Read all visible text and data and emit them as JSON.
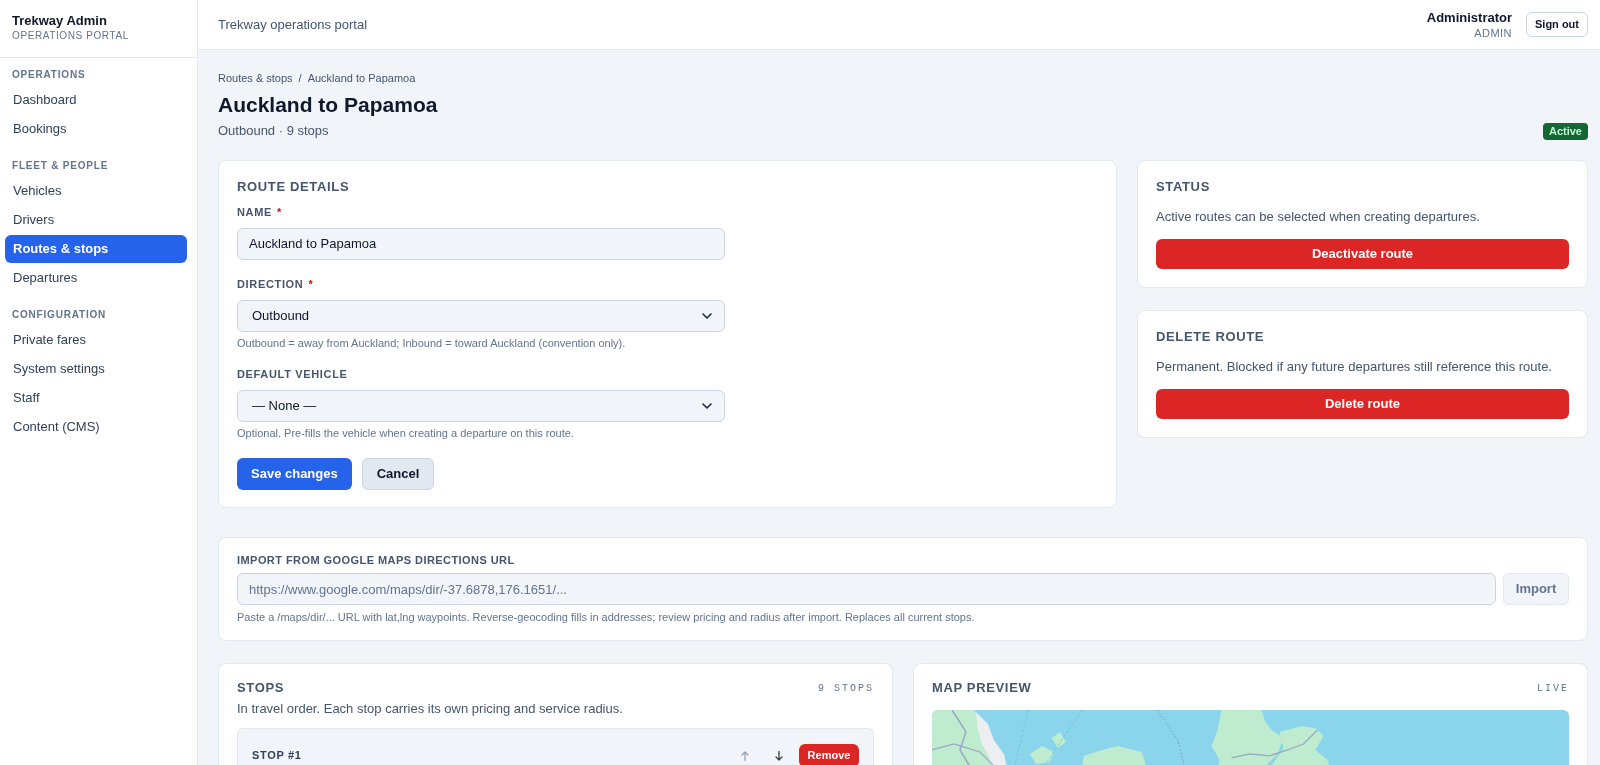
{
  "sidebar": {
    "brand": {
      "title": "Trekway Admin",
      "subtitle": "OPERATIONS PORTAL"
    },
    "sections": [
      {
        "label": "OPERATIONS",
        "items": [
          {
            "label": "Dashboard",
            "selected": false
          },
          {
            "label": "Bookings",
            "selected": false
          }
        ]
      },
      {
        "label": "FLEET & PEOPLE",
        "items": [
          {
            "label": "Vehicles",
            "selected": false
          },
          {
            "label": "Drivers",
            "selected": false
          },
          {
            "label": "Routes & stops",
            "selected": true
          },
          {
            "label": "Departures",
            "selected": false
          }
        ]
      },
      {
        "label": "CONFIGURATION",
        "items": [
          {
            "label": "Private fares",
            "selected": false
          },
          {
            "label": "System settings",
            "selected": false
          },
          {
            "label": "Staff",
            "selected": false
          },
          {
            "label": "Content (CMS)",
            "selected": false
          }
        ]
      }
    ]
  },
  "header": {
    "title": "Trekway operations portal",
    "user_name": "Administrator",
    "user_role": "ADMIN",
    "sign_out": "Sign out"
  },
  "page": {
    "breadcrumb": [
      "Routes & stops",
      "Auckland to Papamoa"
    ],
    "breadcrumb_separator": "/",
    "title": "Auckland to Papamoa",
    "subtitle": "Outbound · 9 stops",
    "status_badge": "Active"
  },
  "route_details": {
    "title": "ROUTE DETAILS",
    "fields": [
      {
        "kind": "text",
        "label": "NAME",
        "required_mark": "*",
        "value": "Auckland to Papamoa"
      },
      {
        "kind": "select",
        "label": "DIRECTION",
        "required_mark": "*",
        "value": "Outbound",
        "help": "Outbound = away from Auckland; Inbound = toward Auckland (convention only)."
      },
      {
        "kind": "select",
        "label": "DEFAULT VEHICLE",
        "value": "— None —",
        "help": "Optional. Pre-fills the vehicle when creating a departure on this route."
      }
    ],
    "buttons": [
      {
        "kind": "primary",
        "label": "Save changes"
      },
      {
        "kind": "secondary",
        "label": "Cancel"
      }
    ]
  },
  "side_cards": [
    {
      "title": "STATUS",
      "text": "Active routes can be selected when creating departures.",
      "button": "Deactivate route"
    },
    {
      "title": "DELETE ROUTE",
      "text": "Permanent. Blocked if any future departures still reference this route.",
      "button": "Delete route"
    }
  ],
  "import": {
    "label": "IMPORT FROM GOOGLE MAPS DIRECTIONS URL",
    "placeholder": "https://www.google.com/maps/dir/-37.6878,176.1651/...",
    "button": "Import",
    "button_disabled": true,
    "help": "Paste a /maps/dir/... URL with lat,lng waypoints. Reverse-geocoding fills in addresses; review pricing and radius after import. Replaces all current stops."
  },
  "stops": {
    "title": "STOPS",
    "count": "9 STOPS",
    "description": "In travel order. Each stop carries its own pricing and service radius.",
    "items": [
      {
        "label": "STOP #1",
        "up_disabled": true,
        "down_disabled": false,
        "remove": "Remove"
      }
    ]
  },
  "map_preview": {
    "title": "MAP PREVIEW",
    "badge": "LIVE"
  }
}
